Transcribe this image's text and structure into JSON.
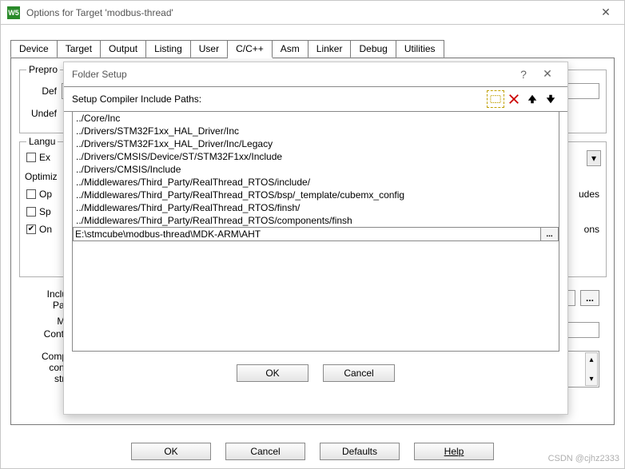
{
  "window": {
    "title": "Options for Target 'modbus-thread'",
    "icon_text": "W5"
  },
  "tabs": [
    "Device",
    "Target",
    "Output",
    "Listing",
    "User",
    "C/C++",
    "Asm",
    "Linker",
    "Debug",
    "Utilities"
  ],
  "active_tab": "C/C++",
  "bg_panel": {
    "group_preproc": "Prepro",
    "define_label": "Def",
    "undef_label": "Undef",
    "group_lang": "Langu",
    "chk_exec": "Ex",
    "optim_label": "Optimiz",
    "chk_op": "Op",
    "chk_sp": "Sp",
    "chk_on": "On",
    "on_checked": "✔",
    "right_udes": "udes",
    "right_ons": "ons",
    "include_paths": "Inclu\nPat",
    "misc": "Mi",
    "controls": "Contr",
    "comp_ctrl": "Comp\ncont\nstri"
  },
  "modal": {
    "title": "Folder Setup",
    "toolbar_label": "Setup Compiler Include Paths:",
    "paths": [
      "../Core/Inc",
      "../Drivers/STM32F1xx_HAL_Driver/Inc",
      "../Drivers/STM32F1xx_HAL_Driver/Inc/Legacy",
      "../Drivers/CMSIS/Device/ST/STM32F1xx/Include",
      "../Drivers/CMSIS/Include",
      "../Middlewares/Third_Party/RealThread_RTOS/include/",
      "../Middlewares/Third_Party/RealThread_RTOS/bsp/_template/cubemx_config",
      "../Middlewares/Third_Party/RealThread_RTOS/finsh/",
      "../Middlewares/Third_Party/RealThread_RTOS/components/finsh"
    ],
    "editing_path": "E:\\stmcube\\modbus-thread\\MDK-ARM\\AHT",
    "ok": "OK",
    "cancel": "Cancel"
  },
  "buttons": {
    "ok": "OK",
    "cancel": "Cancel",
    "defaults": "Defaults",
    "help": "Help"
  },
  "watermark": "CSDN @cjhz2333"
}
